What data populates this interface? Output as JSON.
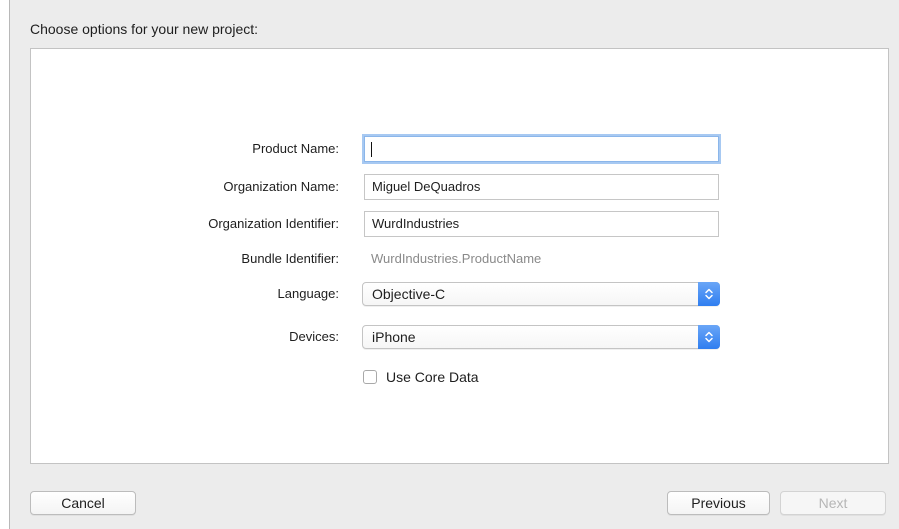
{
  "header": {
    "title": "Choose options for your new project:"
  },
  "form": {
    "product_name": {
      "label": "Product Name:",
      "value": ""
    },
    "organization_name": {
      "label": "Organization Name:",
      "value": "Miguel DeQuadros"
    },
    "organization_identifier": {
      "label": "Organization Identifier:",
      "value": "WurdIndustries"
    },
    "bundle_identifier": {
      "label": "Bundle Identifier:",
      "value": "WurdIndustries.ProductName"
    },
    "language": {
      "label": "Language:",
      "value": "Objective-C"
    },
    "devices": {
      "label": "Devices:",
      "value": "iPhone"
    },
    "core_data": {
      "label": "Use Core Data",
      "checked": false
    }
  },
  "footer": {
    "cancel_label": "Cancel",
    "previous_label": "Previous",
    "next_label": "Next"
  },
  "colors": {
    "accent": "#2f7ef0",
    "focus_ring": "#a7c9f2",
    "sheet_background": "#ececec",
    "disabled_text": "#b6b6b6"
  },
  "icons": {
    "popup_stepper": "up-down-chevron-icon"
  }
}
